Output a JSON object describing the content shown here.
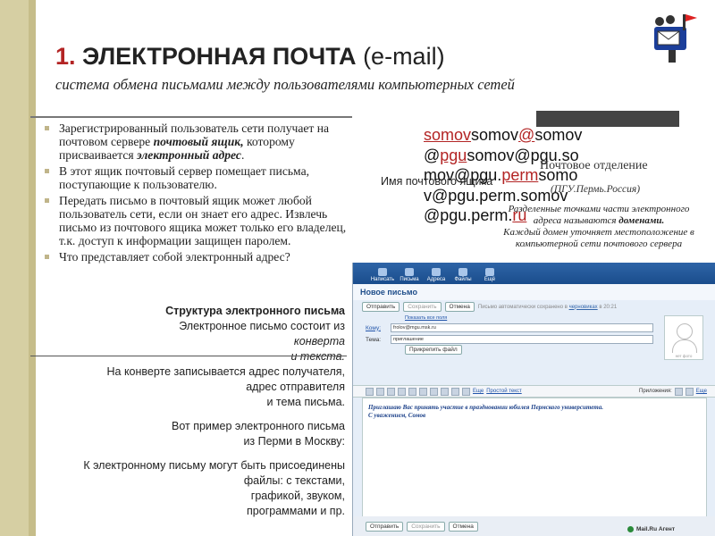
{
  "slide": {
    "title_num": "1.",
    "title_caps": "ЭЛЕКТРОННАЯ ПОЧТА",
    "title_paren": " (e-mail)",
    "subtitle": "система обмена письмами между пользователями компьютерных сетей"
  },
  "bullets": {
    "b1_pre": "Зарегистрированный пользователь сети получает на почтовом сервере ",
    "b1_hl1": "почтовый ящик,",
    "b1_mid": " которому присваивается ",
    "b1_hl2": "электронный адрес",
    "b1_end": ".",
    "b2": "В этот ящик почтовый сервер помещает письма, поступающие к пользователю.",
    "b3": "Передать письмо в почтовый ящик может любой пользователь сети, если он знает его адрес. Извлечь письмо из почтового ящика может только его владелец, т.к. доступ к информации защищен паролем.",
    "b4": "Что представляет собой электронный адрес?"
  },
  "address": {
    "l1a": "somov",
    "l1b": "somov",
    "l1c": "@",
    "l1d": "somov",
    "l2a": "@",
    "l2b": "pgu",
    "l2c": "somov@pgu.so",
    "l3a": "mov@pgu.",
    "l3b": "perm",
    "l3c": "somo",
    "l4": "v@pgu.perm.somov",
    "l5a": "@pgu.perm.",
    "l5b": "ru",
    "post_office": "Почтовое отделение",
    "post_city": "(ПГУ.Пермь.Россия)",
    "box_label": "Имя почтового ящика",
    "domain_note_1": "Разделенные точками части электронного адреса называются ",
    "domain_note_hl": "доменами.",
    "domain_note_2": "Каждый домен уточняет местоположение в компьютерной сети почтового сервера"
  },
  "structure": {
    "heading": "Структура электронного письма",
    "l1": "Электронное письмо состоит из",
    "l2": "конверта",
    "l3": "и текста.",
    "l4": "На конверте записывается адрес получателя,",
    "l5": "адрес отправителя",
    "l6": "и тема письма.",
    "l7": "Вот пример электронного письма",
    "l8": "из Перми в Москву:",
    "l9": "К электронному письму могут быть присоединены",
    "l10": "файлы: с текстами,",
    "l11": "графикой, звуком,",
    "l12": "программами и пр."
  },
  "mail": {
    "nav": [
      "Написать",
      "Письма",
      "Адреса",
      "Файлы",
      "Ещё"
    ],
    "heading": "Новое письмо",
    "send": "Отправить",
    "save": "Сохранить",
    "cancel": "Отмена",
    "autosave_pre": "Письмо автоматически сохранено в ",
    "autosave_link": "черновиках",
    "autosave_post": " в 20:21",
    "show_all": "Показать все поля",
    "to_label": "Кому:",
    "to_value": "frolov@mgu.msk.ru",
    "subject_label": "Тема:",
    "subject_value": "приглашение",
    "attach": "Прикрепить файл",
    "avatar_caption": "нет фото",
    "fmt_more": "Еще",
    "fmt_plain": "Простой текст",
    "fmt_apps": "Приложения:",
    "fmt_more2": "Еще",
    "body_l1": "Приглашаю Вас принять участие в праздновании юбилея Пермского университета.",
    "body_l2": "С уважением, Сомов",
    "agent": "Mail.Ru Агент"
  }
}
